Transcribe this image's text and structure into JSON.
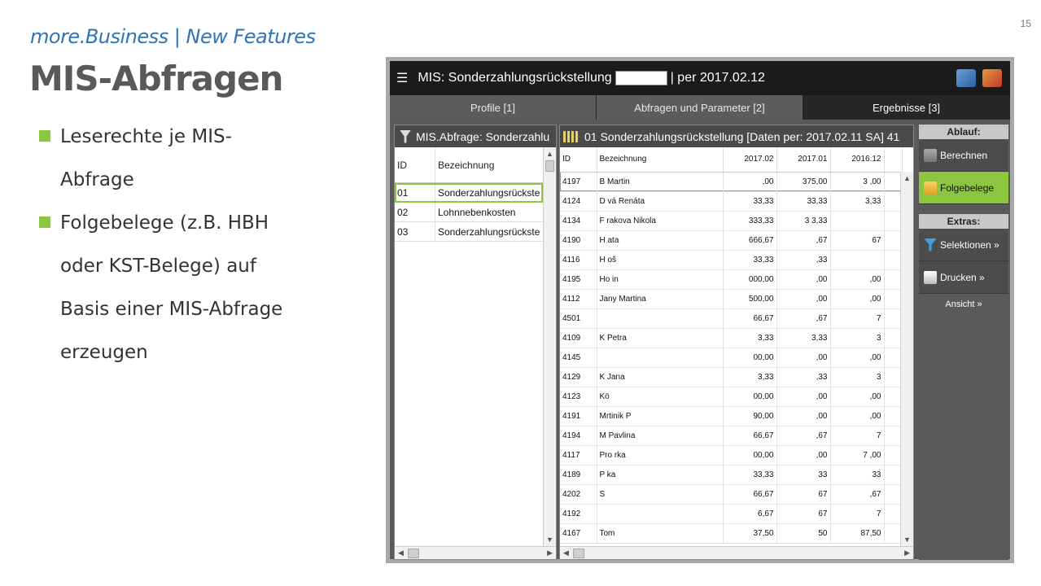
{
  "slide": {
    "number": "15",
    "subtitle": "more.Business | New Features",
    "title": "MIS-Abfragen",
    "bullets": [
      "Leserechte je MIS-Abfrage",
      "Folgebelege (z.B. HBH oder KST-Belege) auf Basis einer MIS-Abfrage erzeugen"
    ]
  },
  "colors": {
    "accent": "#8cc63f",
    "subtitle": "#2e75b6",
    "titlebar": "#1b1b1b"
  },
  "window": {
    "menu_icon": "☰",
    "title_prefix": "MIS: Sonderzahlungsrückstellung",
    "title_suffix": "| per 2017.02.12",
    "icons": [
      "mail-icon",
      "home-icon"
    ]
  },
  "tabs": [
    {
      "label": "Profile [1]"
    },
    {
      "label": "Abfragen und Parameter [2]"
    },
    {
      "label": "Ergebnisse [3]"
    }
  ],
  "left_pane": {
    "title": "MIS.Abfrage: Sonderzahlu",
    "columns": [
      "ID",
      "Bezeichnung"
    ],
    "rows": [
      {
        "id": "01",
        "name": "Sonderzahlungsrückste"
      },
      {
        "id": "02",
        "name": "Lohnnebenkosten"
      },
      {
        "id": "03",
        "name": "Sonderzahlungsrückste"
      }
    ]
  },
  "right_pane": {
    "title": "01 Sonderzahlungsrückstellung  [Daten per: 2017.02.11 SA]  41",
    "columns": [
      "ID",
      "Bezeichnung",
      "2017.02",
      "2017.01",
      "2016.12"
    ],
    "rows": [
      [
        "4197",
        "B     Martin",
        ",00",
        "375,00",
        "3    ,00"
      ],
      [
        "4124",
        "D     vá Renáta",
        "33,33",
        "33,33",
        "  3,33"
      ],
      [
        "4134",
        "F  rakova Nikola",
        "333,33",
        "3  3,33",
        "  "
      ],
      [
        "4190",
        "H       ata",
        "666,67",
        "   ,67",
        "67"
      ],
      [
        "4116",
        "H      oš",
        "33,33",
        "  ,33",
        ""
      ],
      [
        "4195",
        "Ho     in",
        "000,00",
        ",00",
        ",00"
      ],
      [
        "4112",
        "Jany    Martina",
        "500,00",
        "  ,00",
        "  ,00"
      ],
      [
        "4501",
        "",
        "66,67",
        "  ,67",
        "7"
      ],
      [
        "4109",
        "K      Petra",
        "3,33",
        "3,33",
        "  3"
      ],
      [
        "4145",
        "",
        "00,00",
        "  ,00",
        "  ,00"
      ],
      [
        "4129",
        "K       Jana",
        "3,33",
        ",33",
        "3"
      ],
      [
        "4123",
        "Kö",
        "00,00",
        ",00",
        "  ,00"
      ],
      [
        "4191",
        "Mrtinik P",
        "90,00",
        ",00",
        "  ,00"
      ],
      [
        "4194",
        "M        Pavlina",
        "66,67",
        "  ,67",
        "7"
      ],
      [
        "4117",
        "Pro       rka",
        "00,00",
        "  ,00",
        "7   ,00"
      ],
      [
        "4189",
        "P       ka",
        "33,33",
        "33",
        "33"
      ],
      [
        "4202",
        "S",
        "66,67",
        "67",
        "  ,67"
      ],
      [
        "4192",
        "",
        "6,67",
        "  67",
        "7"
      ],
      [
        "4167",
        "Tom",
        "37,50",
        "50",
        "  87,50"
      ]
    ]
  },
  "sidebar": {
    "ablauf_label": "Ablauf:",
    "berechnen_label": "Berechnen",
    "folgebelege_label": "Folgebelege",
    "extras_label": "Extras:",
    "selektionen_label": "Selektionen »",
    "drucken_label": "Drucken »",
    "ansicht_label": "Ansicht »"
  }
}
